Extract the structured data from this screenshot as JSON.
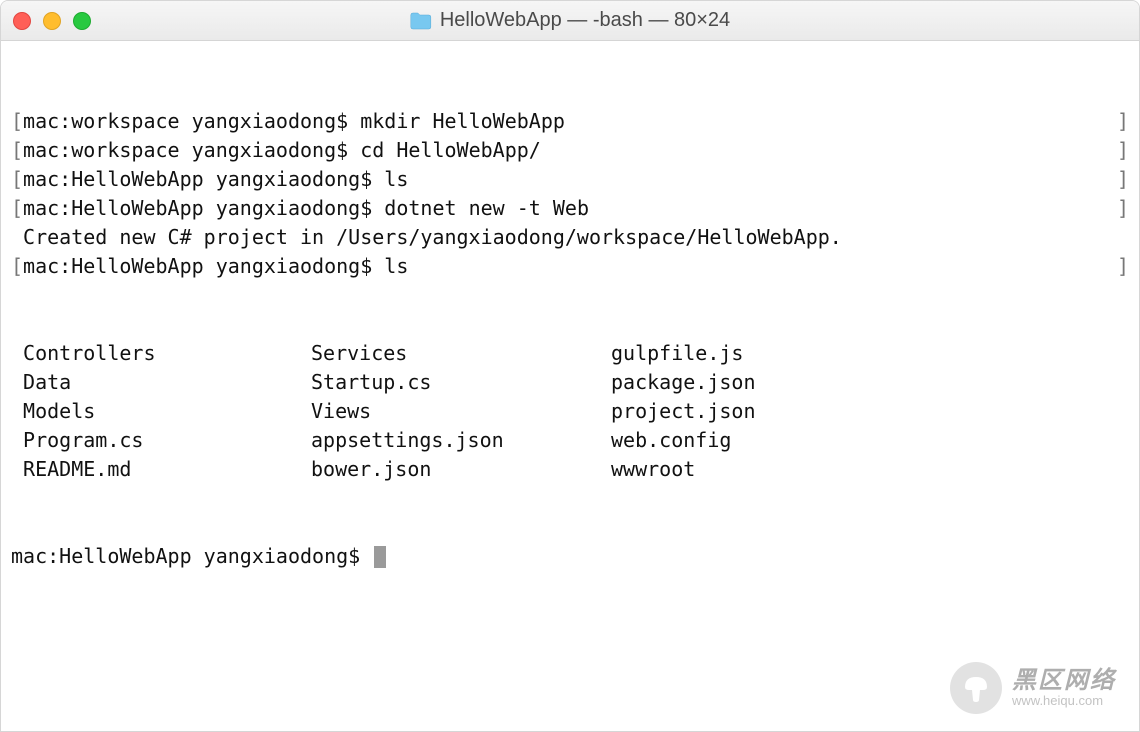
{
  "window": {
    "title": "HelloWebApp — -bash — 80×24"
  },
  "terminal": {
    "lines": [
      {
        "bracketed": true,
        "prompt": "mac:workspace yangxiaodong$ ",
        "cmd": "mkdir HelloWebApp"
      },
      {
        "bracketed": true,
        "prompt": "mac:workspace yangxiaodong$ ",
        "cmd": "cd HelloWebApp/"
      },
      {
        "bracketed": true,
        "prompt": "mac:HelloWebApp yangxiaodong$ ",
        "cmd": "ls"
      },
      {
        "bracketed": true,
        "prompt": "mac:HelloWebApp yangxiaodong$ ",
        "cmd": "dotnet new -t Web"
      },
      {
        "bracketed": false,
        "text": " Created new C# project in /Users/yangxiaodong/workspace/HelloWebApp."
      },
      {
        "bracketed": true,
        "prompt": "mac:HelloWebApp yangxiaodong$ ",
        "cmd": "ls"
      }
    ],
    "listing": {
      "col1": [
        "Controllers",
        "Data",
        "Models",
        "Program.cs",
        "README.md"
      ],
      "col2": [
        "Services",
        "Startup.cs",
        "Views",
        "appsettings.json",
        "bower.json"
      ],
      "col3": [
        "gulpfile.js",
        "package.json",
        "project.json",
        "web.config",
        "wwwroot"
      ]
    },
    "current_prompt": "mac:HelloWebApp yangxiaodong$ "
  },
  "watermark": {
    "main": "黑区网络",
    "sub": "www.heiqu.com"
  }
}
